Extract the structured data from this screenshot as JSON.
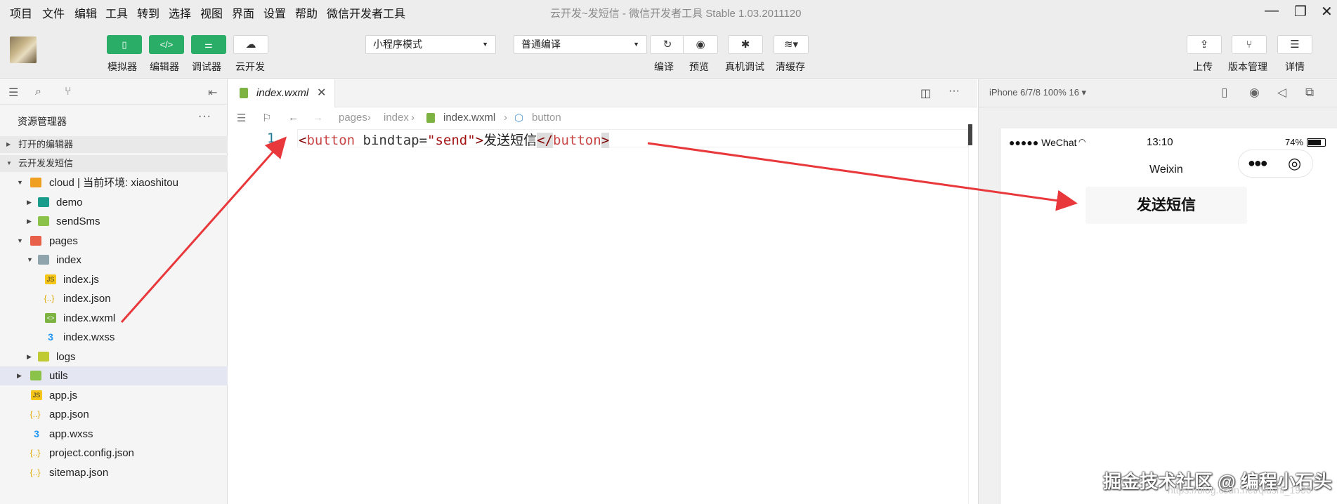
{
  "menubar": {
    "items": [
      "项目",
      "文件",
      "编辑",
      "工具",
      "转到",
      "选择",
      "视图",
      "界面",
      "设置",
      "帮助",
      "微信开发者工具"
    ],
    "window_title": "云开发~发短信 - 微信开发者工具 Stable 1.03.2011120",
    "controls": {
      "minimize": "—",
      "maximize": "❐",
      "close": "✕"
    }
  },
  "toolbar": {
    "simulator_label": "模拟器",
    "editor_label": "编辑器",
    "debugger_label": "调试器",
    "cloud_label": "云开发",
    "mode_select": "小程序模式",
    "compile_select": "普通编译",
    "compile_label": "编译",
    "preview_label": "预览",
    "remote_debug_label": "真机调试",
    "clear_cache_label": "清缓存",
    "upload_label": "上传",
    "version_label": "版本管理",
    "details_label": "详情"
  },
  "sidebar": {
    "title": "资源管理器",
    "more": "···",
    "open_editors": "打开的编辑器",
    "project": "云开发发短信",
    "tree": [
      {
        "label": "cloud | 当前环境: xiaoshitou"
      },
      {
        "label": "demo"
      },
      {
        "label": "sendSms"
      },
      {
        "label": "pages"
      },
      {
        "label": "index"
      },
      {
        "label": "index.js"
      },
      {
        "label": "index.json"
      },
      {
        "label": "index.wxml"
      },
      {
        "label": "index.wxss"
      },
      {
        "label": "logs"
      },
      {
        "label": "utils"
      },
      {
        "label": "app.js"
      },
      {
        "label": "app.json"
      },
      {
        "label": "app.wxss"
      },
      {
        "label": "project.config.json"
      },
      {
        "label": "sitemap.json"
      }
    ]
  },
  "editor": {
    "tab_label": "index.wxml",
    "breadcrumb": [
      "pages",
      "index",
      "index.wxml",
      "button"
    ],
    "line_number": "1",
    "code": {
      "open_lt": "<",
      "tag": "button",
      "attr": " bindtap=",
      "value": "\"send\"",
      "open_gt": ">",
      "text": "发送短信",
      "close_lt": "</",
      "close_tag": "button",
      "close_gt": ">"
    }
  },
  "simulator": {
    "device": "iPhone 6/7/8 100% 16 ▾",
    "carrier": "●●●●● WeChat",
    "time": "13:10",
    "battery": "74%",
    "nav_title": "Weixin",
    "button_label": "发送短信"
  },
  "watermark": {
    "text": "掘金技术社区 @ 编程小石头",
    "url": "https://blog.csdn.net/qiushi_1990"
  },
  "colors": {
    "accent_green": "#2aae67",
    "arrow_red": "#e8383b"
  }
}
